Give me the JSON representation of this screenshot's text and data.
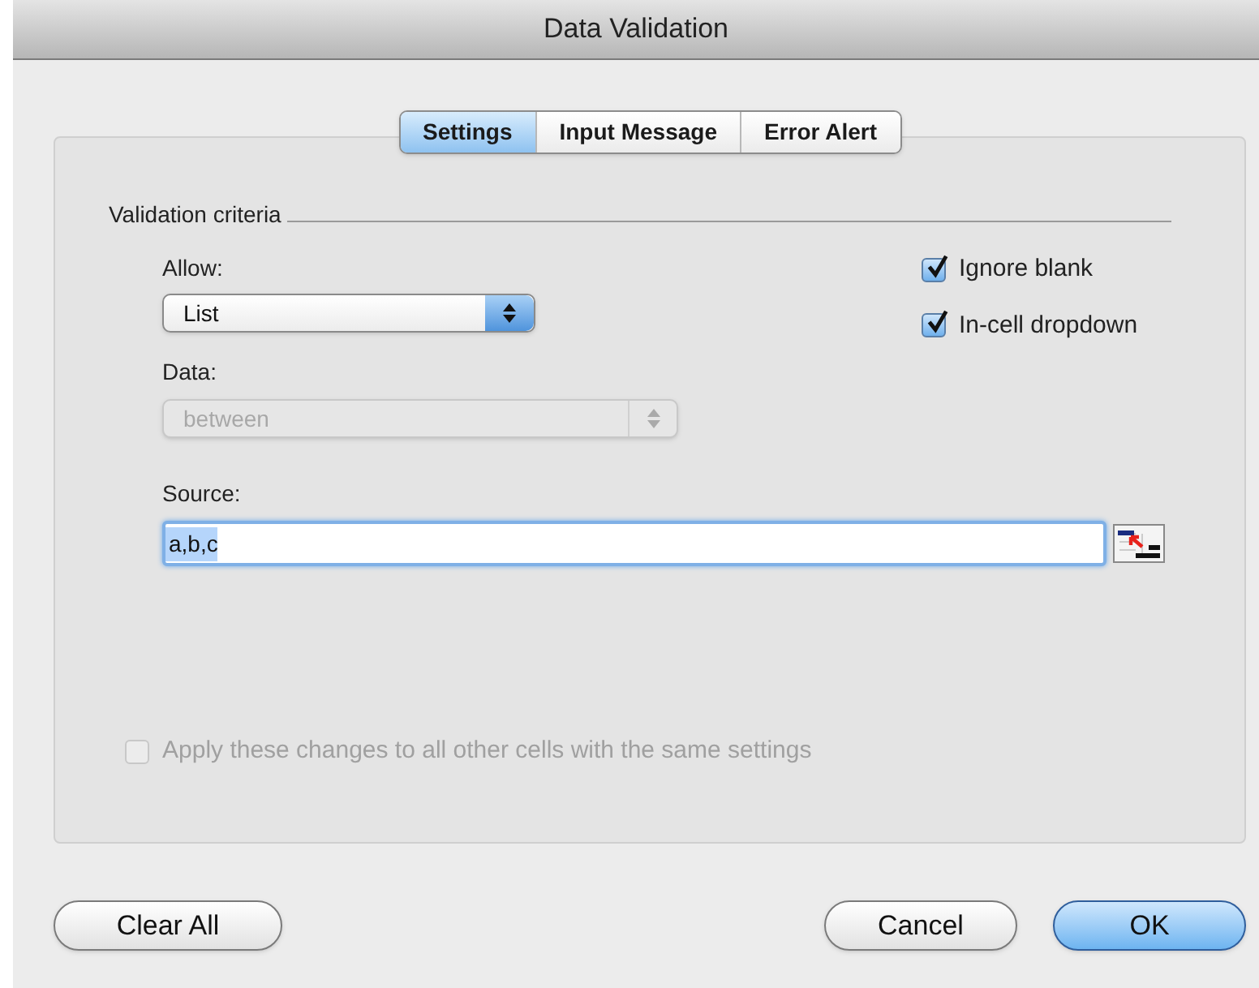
{
  "window": {
    "title": "Data Validation"
  },
  "tabs": [
    {
      "label": "Settings",
      "selected": true
    },
    {
      "label": "Input Message",
      "selected": false
    },
    {
      "label": "Error Alert",
      "selected": false
    }
  ],
  "section": {
    "title": "Validation criteria"
  },
  "allow": {
    "label": "Allow:",
    "value": "List",
    "disabled": false
  },
  "data": {
    "label": "Data:",
    "value": "between",
    "disabled": true
  },
  "options": [
    {
      "label": "Ignore blank",
      "checked": true,
      "disabled": false
    },
    {
      "label": "In-cell dropdown",
      "checked": true,
      "disabled": false
    }
  ],
  "source": {
    "label": "Source:",
    "value": "a,b,c"
  },
  "apply_all": {
    "label": "Apply these changes to all other cells with the same settings",
    "checked": false,
    "disabled": true
  },
  "buttons": [
    {
      "label": "Clear All",
      "kind": "secondary"
    },
    {
      "label": "Cancel",
      "kind": "secondary"
    },
    {
      "label": "OK",
      "kind": "default"
    }
  ]
}
